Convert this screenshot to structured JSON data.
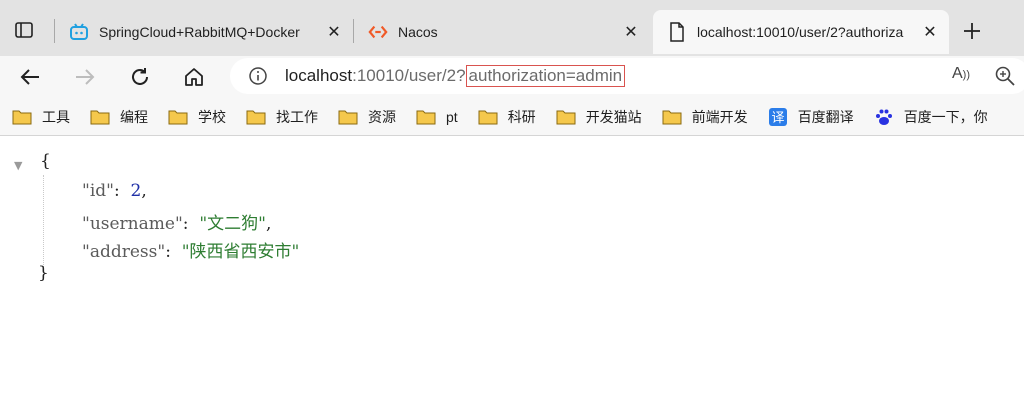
{
  "tabs": [
    {
      "title": "SpringCloud+RabbitMQ+Docker",
      "favicon": "bilibili-icon",
      "active": false
    },
    {
      "title": "Nacos",
      "favicon": "nacos-icon",
      "active": false
    },
    {
      "title": "localhost:10010/user/2?authoriza",
      "favicon": "page-icon",
      "active": true
    }
  ],
  "address": {
    "host": "localhost",
    "path": ":10010/user/2?",
    "query": "authorization=admin"
  },
  "bookmarks": [
    {
      "label": "工具",
      "icon": "folder-icon"
    },
    {
      "label": "编程",
      "icon": "folder-icon"
    },
    {
      "label": "学校",
      "icon": "folder-icon"
    },
    {
      "label": "找工作",
      "icon": "folder-icon"
    },
    {
      "label": "资源",
      "icon": "folder-icon"
    },
    {
      "label": "pt",
      "icon": "folder-icon"
    },
    {
      "label": "科研",
      "icon": "folder-icon"
    },
    {
      "label": "开发猫站",
      "icon": "folder-icon"
    },
    {
      "label": "前端开发",
      "icon": "folder-icon"
    },
    {
      "label": "百度翻译",
      "icon": "translate-icon"
    },
    {
      "label": "百度一下，你",
      "icon": "baidu-icon"
    }
  ],
  "json_view": {
    "open_brace": "{",
    "close_brace": "}",
    "fields": [
      {
        "key": "\"id\"",
        "value": "2",
        "type": "number"
      },
      {
        "key": "\"username\"",
        "value": "\"文二狗\"",
        "type": "string"
      },
      {
        "key": "\"address\"",
        "value": "\"陕西省西安市\"",
        "type": "string"
      }
    ]
  },
  "colors": {
    "tabstrip_bg": "#e3e3e3",
    "toolbar_bg": "#f7f7f7",
    "highlight_border": "#d9534f",
    "json_number": "#1f2fa7",
    "json_string": "#2e7d32",
    "folder_yellow": "#f5c84c"
  }
}
